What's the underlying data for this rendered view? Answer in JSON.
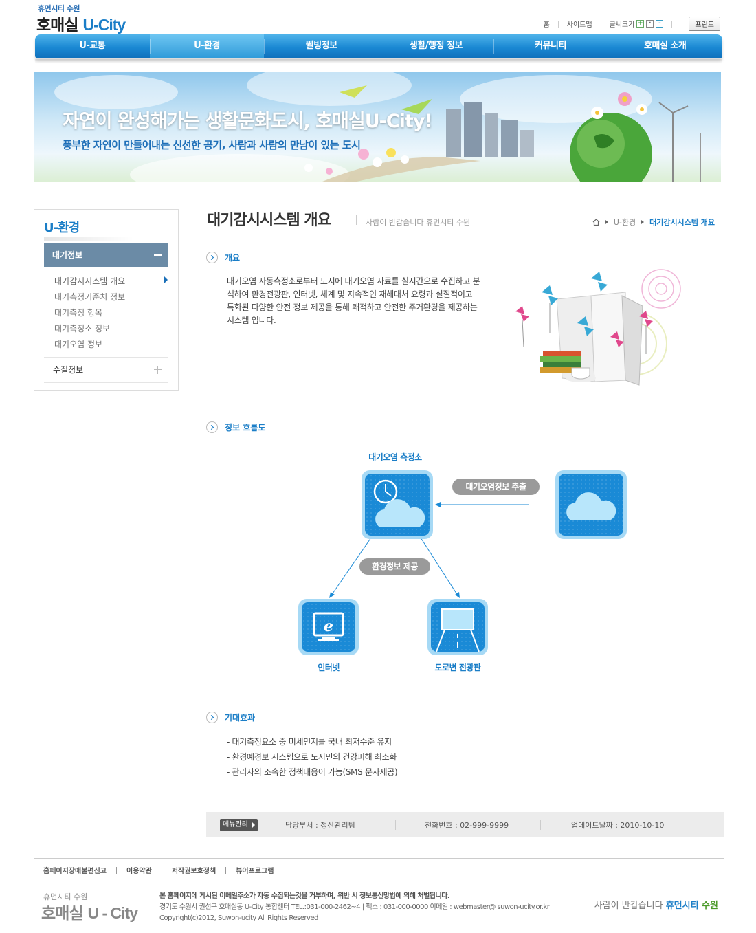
{
  "header": {
    "logo_sub": "휴먼시티 수원",
    "logo_main": "호매실",
    "logo_brand": "U-City",
    "util": {
      "home": "홈",
      "sitemap": "사이트맵",
      "font_size": "글씨크기",
      "font_plus": "+",
      "font_mid": "·",
      "font_minus": "-",
      "print": "프린트"
    }
  },
  "gnb": [
    {
      "label": "U-교통"
    },
    {
      "label": "U-환경"
    },
    {
      "label": "웰빙정보"
    },
    {
      "label": "생활/행정 정보"
    },
    {
      "label": "커뮤니티"
    },
    {
      "label": "호매실 소개"
    }
  ],
  "banner": {
    "title": "자연이 완성해가는 생활문화도시, 호매실U-City!",
    "subtitle": "풍부한 자연이 만들어내는 신선한 공기, 사람과 사람의 만남이 있는 도시"
  },
  "lnb": {
    "title": "U-환경",
    "head": "대기정보",
    "items": [
      "대기감시시스템 개요",
      "대기측정기준치 정보",
      "대기측정 항목",
      "대기측정소 정보",
      "대기오염 정보"
    ],
    "second": "수질정보"
  },
  "content": {
    "title": "대기감시시스템 개요",
    "tag": "사람이 반갑습니다 휴먼시티 수원",
    "breadcrumb": {
      "level1": "U-환경",
      "current": "대기감시시스템 개요"
    },
    "overview": {
      "heading": "개요",
      "text": "대기오염 자동측정소로부터 도시에 대기오염 자료를 실시간으로 수집하고 분석하여 환경전광판, 인터넷, 체계 및 지속적인 재해대처 요령과 실질적이고 특화된 다양한 안전 정보 제공을 통해 쾌적하고 안전한 주거환경을 제공하는 시스템 입니다."
    },
    "flow": {
      "heading": "정보 흐름도",
      "station": "대기오염 측정소",
      "extract": "대기오염정보 추출",
      "provide": "환경정보 제공",
      "internet": "인터넷",
      "roadside": "도로변 전광판"
    },
    "effect": {
      "heading": "기대효과",
      "items": [
        "- 대기측정요소 중 미세먼지를 국내 최저수준 유지",
        "- 환경예경보 시스템으로 도시민의 건강피해 최소화",
        "- 관리자의 조속한 정책대응이 가능(SMS 문자제공)"
      ]
    },
    "info_bar": {
      "menu_btn": "메뉴관리",
      "dept": "담당부서 : 정산관리팀",
      "phone": "전화번호 : 02-999-9999",
      "updated": "업데이트날짜 : 2010-10-10"
    }
  },
  "footer": {
    "links": [
      "홈페이지장애불편신고",
      "이용약관",
      "저작권보호정책",
      "뷰어프로그램"
    ],
    "logo_sub": "휴먼시티 수원",
    "logo_main": "호매실",
    "logo_brand": "U - City",
    "notice": "본 홈페이지에 게시된 이메일주소가 자동 수집되는것을 거부하며, 위반 시 정보통신망법에 의해 처벌됩니다.",
    "address": "경기도 수원시 권선구 호매실동 U-City 통합센터 TEL.:031-000-2462~4  |  팩스 : 031-000-0000   이메일 : webmaster@ suwon-ucity.or.kr",
    "copyright": "Copyright(c)2012, Suwon-ucity All Rights Reserved",
    "slogan": "사람이 반갑습니다",
    "slogan_brand1": "휴먼시티",
    "slogan_brand2": "수원"
  },
  "colors": {
    "accent": "#1b7ec7",
    "nav": "#1a88d3",
    "lnb_head": "#6b8ba6",
    "green": "#4c9a2a"
  }
}
